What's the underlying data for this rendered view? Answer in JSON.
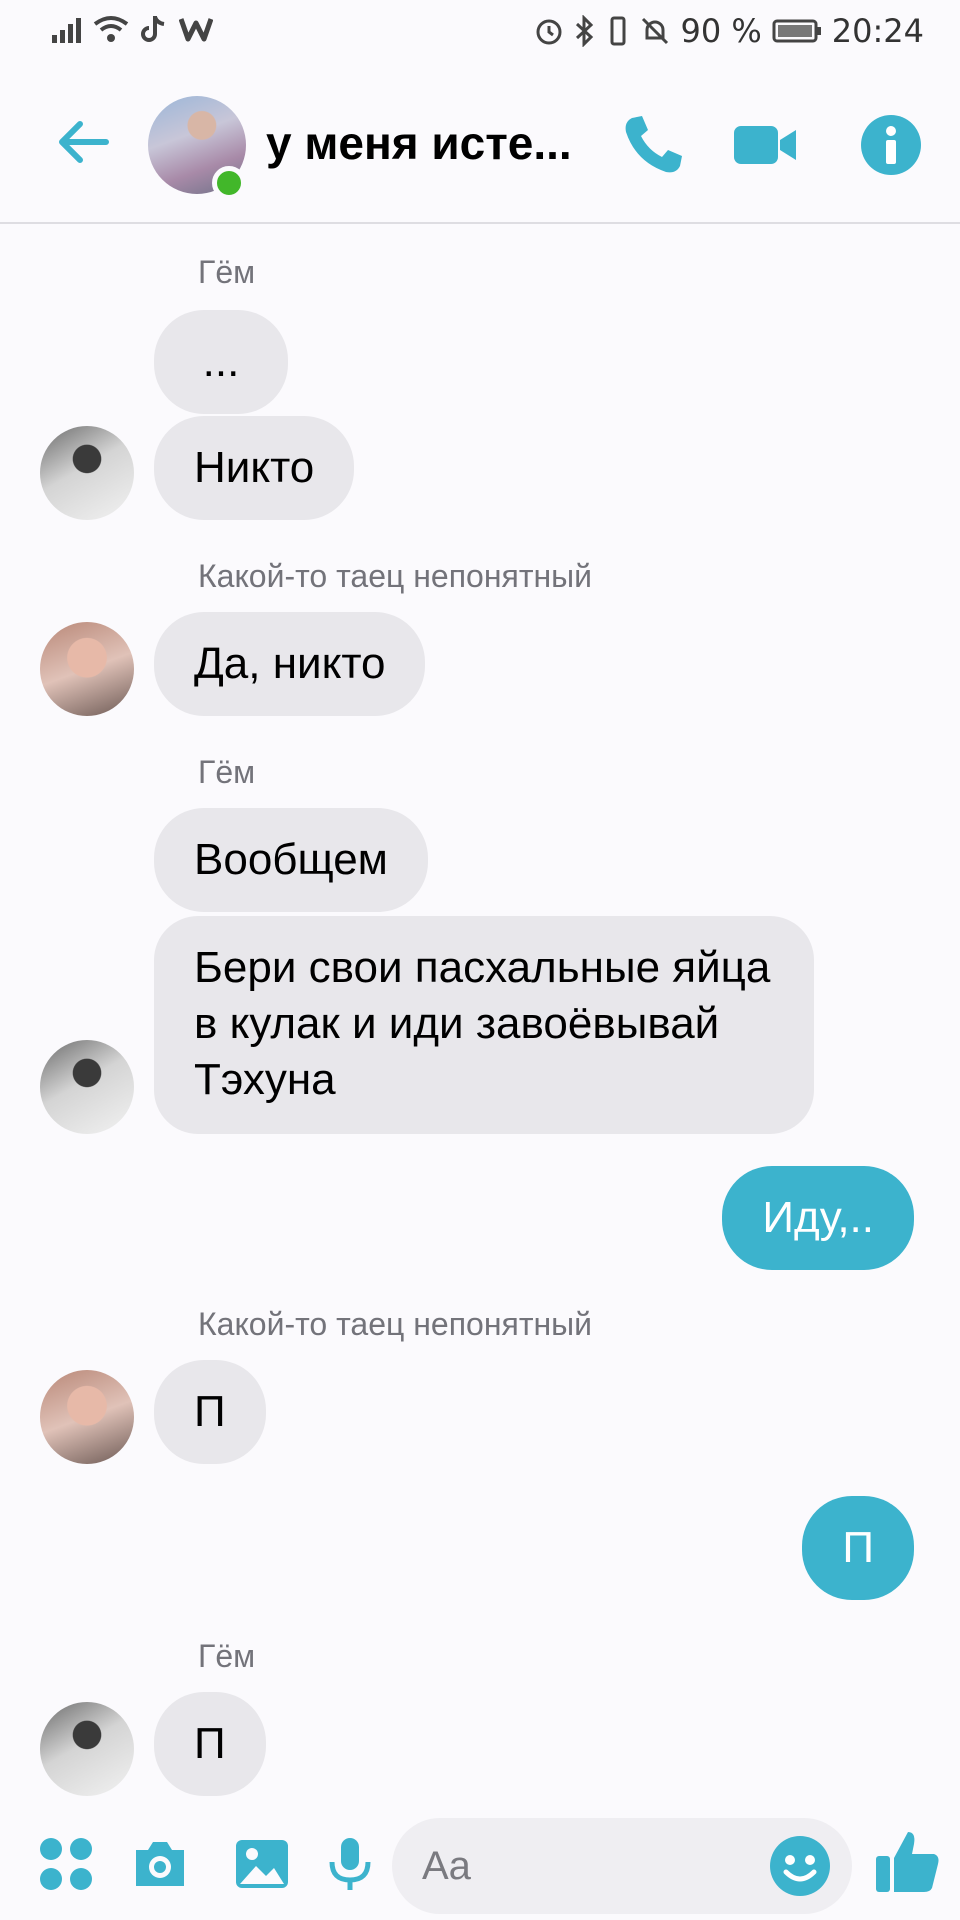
{
  "status_bar": {
    "battery": "90 %",
    "time": "20:24"
  },
  "header": {
    "title": "у меня исте..."
  },
  "messages": [
    {
      "sender": "Гём",
      "text": "..."
    },
    {
      "text": "Никто"
    },
    {
      "sender": "Какой-то таец непонятный",
      "text": "Да, никто"
    },
    {
      "sender": "Гём",
      "text": "Вообщем"
    },
    {
      "text": "Бери свои пасхальные яйца в кулак и иди завоёвывай Тэхуна"
    },
    {
      "text": "Иду,.."
    },
    {
      "sender": "Какой-то таец непонятный",
      "text": "П"
    },
    {
      "text": "П"
    },
    {
      "sender": "Гём",
      "text": "П"
    }
  ],
  "composer": {
    "placeholder": "Aa"
  },
  "colors": {
    "accent": "#3cb3cd",
    "incoming_bubble": "#e8e7eb",
    "online": "#42b72a"
  }
}
